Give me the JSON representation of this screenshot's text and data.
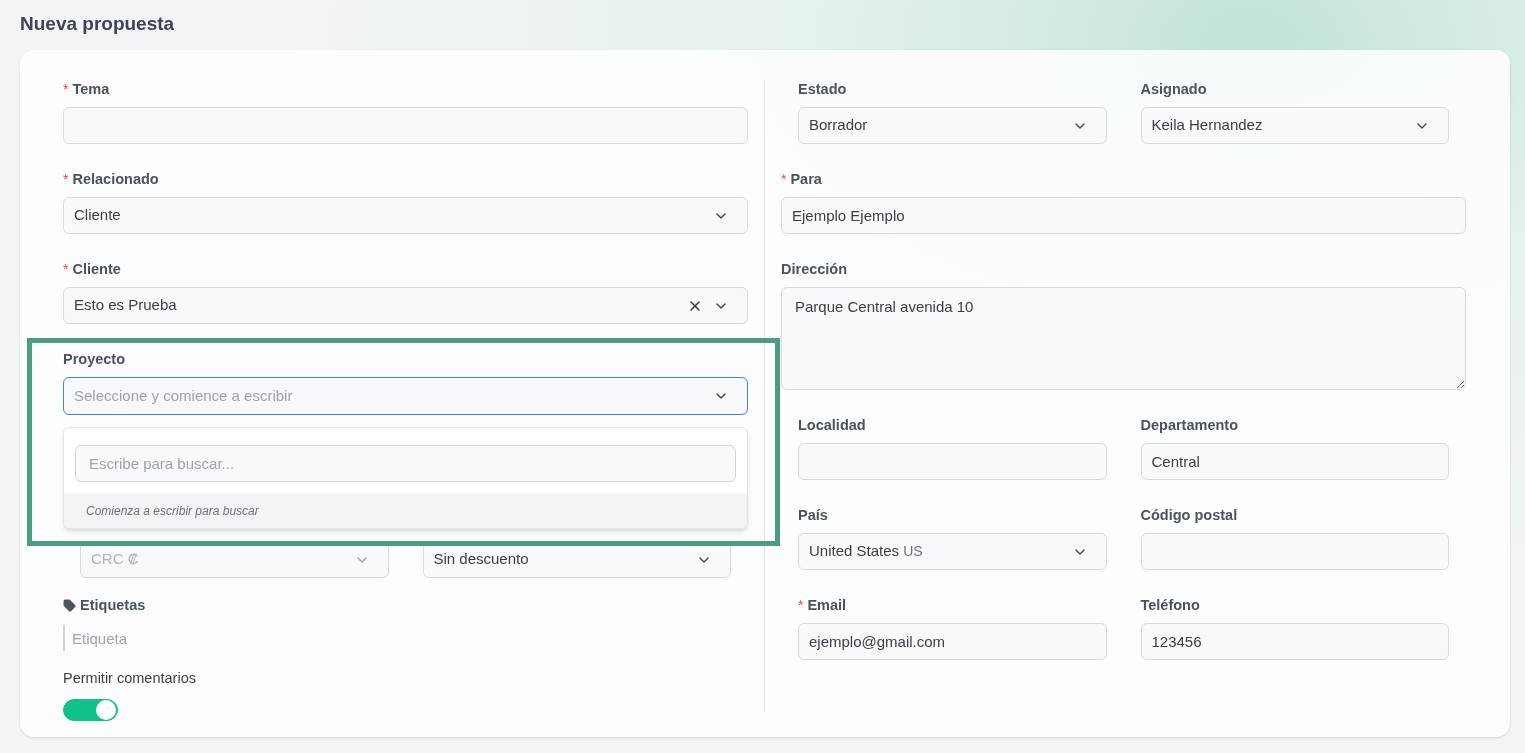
{
  "page_title": "Nueva propuesta",
  "left_fields": [
    {
      "kind": "text",
      "label": "Tema",
      "required_mark": "*"
    },
    {
      "kind": "select",
      "label": "Relacionado",
      "required_mark": "*",
      "value": "Cliente"
    },
    {
      "kind": "select",
      "label": "Cliente",
      "required_mark": "*",
      "value": "Esto es Prueba",
      "clearable": true
    },
    {
      "kind": "search_select",
      "label": "Proyecto",
      "placeholder": "Seleccione y comience a escribir",
      "focused": true,
      "expanded": true,
      "highlighted": true,
      "search_placeholder": "Escribe para buscar...",
      "hint": "Comienza a escribir para buscar"
    }
  ],
  "pricing_row": [
    {
      "value": "CRC ₡",
      "disabled": true
    },
    {
      "value": "Sin descuento",
      "disabled": false
    }
  ],
  "tags": {
    "label": "Etiquetas",
    "placeholder": "Etiqueta"
  },
  "comments": {
    "label": "Permitir comentarios",
    "on": true
  },
  "right_rows": [
    {
      "kind": "pair",
      "fields": [
        {
          "kind": "select",
          "label": "Estado",
          "value": "Borrador"
        },
        {
          "kind": "select",
          "label": "Asignado",
          "value": "Keila Hernandez"
        }
      ]
    },
    {
      "kind": "full",
      "fields": [
        {
          "kind": "text",
          "label": "Para",
          "required_mark": "*",
          "value": "Ejemplo Ejemplo"
        }
      ]
    },
    {
      "kind": "full",
      "fields": [
        {
          "kind": "textarea",
          "label": "Dirección",
          "value": "Parque Central avenida 10"
        }
      ]
    },
    {
      "kind": "pair",
      "fields": [
        {
          "kind": "text",
          "label": "Localidad"
        },
        {
          "kind": "text",
          "label": "Departamento",
          "value": "Central"
        }
      ]
    },
    {
      "kind": "pair",
      "fields": [
        {
          "kind": "select",
          "label": "País",
          "value": "United States",
          "suffix": "US"
        },
        {
          "kind": "text",
          "label": "Código postal"
        }
      ]
    },
    {
      "kind": "pair",
      "fields": [
        {
          "kind": "text",
          "label": "Email",
          "required_mark": "*",
          "value": "ejemplo@gmail.com"
        },
        {
          "kind": "text",
          "label": "Teléfono",
          "value": "123456"
        }
      ]
    }
  ]
}
